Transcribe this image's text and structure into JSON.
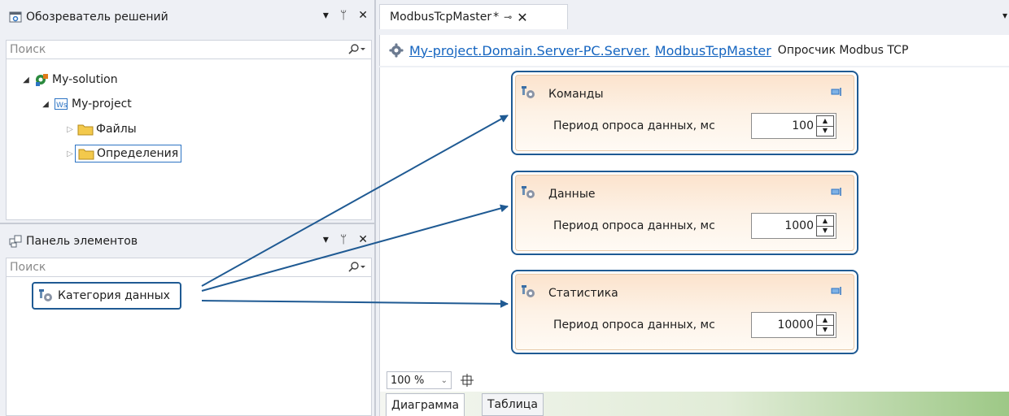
{
  "solution_explorer": {
    "title": "Обозреватель решений",
    "buttons": [
      "▾",
      "ᛘ",
      "✕"
    ],
    "search_placeholder": "Поиск",
    "tree": {
      "solution": "My-solution",
      "project": "My-project",
      "folder_files": "Файлы",
      "folder_definitions": "Определения"
    }
  },
  "toolbox": {
    "title": "Панель элементов",
    "buttons": [
      "▾",
      "ᛘ",
      "✕"
    ],
    "search_placeholder": "Поиск",
    "items": [
      "Категория данных"
    ]
  },
  "document": {
    "tab_label": "ModbusTcpMaster",
    "tab_modified_mark": "*",
    "breadcrumb_path": "My-project.Domain.Server-PC.Server.",
    "breadcrumb_object": "ModbusTcpMaster",
    "breadcrumb_desc": "Опросчик Modbus TCP"
  },
  "nodes": [
    {
      "title": "Команды",
      "prop_label": "Период опроса данных, мс",
      "value": "100"
    },
    {
      "title": "Данные",
      "prop_label": "Период опроса данных, мс",
      "value": "1000"
    },
    {
      "title": "Статистика",
      "prop_label": "Период опроса данных, мс",
      "value": "10000"
    }
  ],
  "zoom": {
    "value": "100 %"
  },
  "bottom_tabs": [
    "Диаграмма",
    "Таблица"
  ],
  "colors": {
    "accent_blue": "#1f5a93",
    "link_blue": "#1565c0",
    "node_fill": "#fce3cd",
    "panel_bg": "#eef0f5"
  }
}
